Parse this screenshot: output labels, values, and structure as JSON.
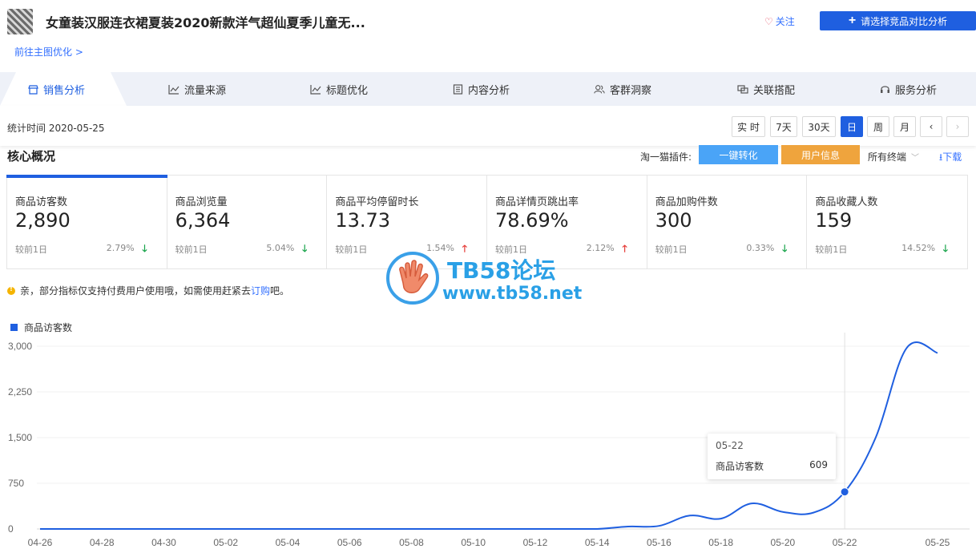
{
  "header": {
    "product_title": "女童装汉服连衣裙夏装2020新款洋气超仙夏季儿童无...",
    "follow_label": "关注",
    "compare_label": "请选择竞品对比分析",
    "back_link": "前往主图优化 >"
  },
  "tabs": [
    {
      "label": "销售分析",
      "icon": "shop-icon",
      "active": true
    },
    {
      "label": "流量来源",
      "icon": "line-chart-icon"
    },
    {
      "label": "标题优化",
      "icon": "line-chart-icon"
    },
    {
      "label": "内容分析",
      "icon": "document-icon"
    },
    {
      "label": "客群洞察",
      "icon": "users-icon"
    },
    {
      "label": "关联搭配",
      "icon": "link-icon"
    },
    {
      "label": "服务分析",
      "icon": "headset-icon"
    }
  ],
  "stats_bar": {
    "date_text": "统计时间 2020-05-25",
    "periods": [
      "实 时",
      "7天",
      "30天",
      "日",
      "周",
      "月"
    ],
    "active_period": "日"
  },
  "core": {
    "title": "核心概况",
    "plugin_label": "淘一猫插件:",
    "plugin_btn_convert": "一键转化",
    "plugin_btn_user": "用户信息",
    "terminal_select": "所有终端",
    "download": "下载"
  },
  "metrics": [
    {
      "label": "商品访客数",
      "value": "2,890",
      "cmp": "较前1日",
      "pct": "2.79%",
      "trend": "down"
    },
    {
      "label": "商品浏览量",
      "value": "6,364",
      "cmp": "较前1日",
      "pct": "5.04%",
      "trend": "down"
    },
    {
      "label": "商品平均停留时长",
      "value": "13.73",
      "cmp": "较前1日",
      "pct": "1.54%",
      "trend": "up"
    },
    {
      "label": "商品详情页跳出率",
      "value": "78.69%",
      "cmp": "较前1日",
      "pct": "2.12%",
      "trend": "up"
    },
    {
      "label": "商品加购件数",
      "value": "300",
      "cmp": "较前1日",
      "pct": "0.33%",
      "trend": "down"
    },
    {
      "label": "商品收藏人数",
      "value": "159",
      "cmp": "较前1日",
      "pct": "14.52%",
      "trend": "down"
    }
  ],
  "notice": {
    "text": "亲，部分指标仅支持付费用户使用哦，如需使用赶紧去",
    "link": "订购",
    "suffix": "吧。"
  },
  "watermark": {
    "title": "TB58论坛",
    "url": "www.tb58.net"
  },
  "tooltip": {
    "date": "05-22",
    "label": "商品访客数",
    "value": "609"
  },
  "colors": {
    "accent": "#1f5fe0",
    "up": "#e53935",
    "down": "#17a34a",
    "plugin_blue": "#4aa4f7",
    "plugin_orange": "#efa43d"
  },
  "chart_data": {
    "type": "line",
    "series": [
      {
        "name": "商品访客数",
        "x": [
          "04-26",
          "04-27",
          "04-28",
          "04-29",
          "04-30",
          "05-01",
          "05-02",
          "05-03",
          "05-04",
          "05-05",
          "05-06",
          "05-07",
          "05-08",
          "05-09",
          "05-10",
          "05-11",
          "05-12",
          "05-13",
          "05-14",
          "05-15",
          "05-16",
          "05-17",
          "05-18",
          "05-19",
          "05-20",
          "05-21",
          "05-22",
          "05-23",
          "05-24",
          "05-25"
        ],
        "values": [
          0,
          0,
          0,
          0,
          0,
          0,
          0,
          0,
          0,
          0,
          0,
          0,
          0,
          0,
          0,
          0,
          0,
          0,
          0,
          40,
          50,
          220,
          170,
          420,
          280,
          270,
          609,
          1500,
          2970,
          2890
        ]
      }
    ],
    "x_tick_labels": [
      "04-26",
      "04-28",
      "04-30",
      "05-02",
      "05-04",
      "05-06",
      "05-08",
      "05-10",
      "05-12",
      "05-14",
      "05-16",
      "05-18",
      "05-20",
      "05-22",
      "05-25"
    ],
    "y_tick_labels": [
      "0",
      "750",
      "1,500",
      "2,250",
      "3,000"
    ],
    "ylim": [
      0,
      3000
    ],
    "grid": true,
    "highlight_x": "05-22"
  }
}
